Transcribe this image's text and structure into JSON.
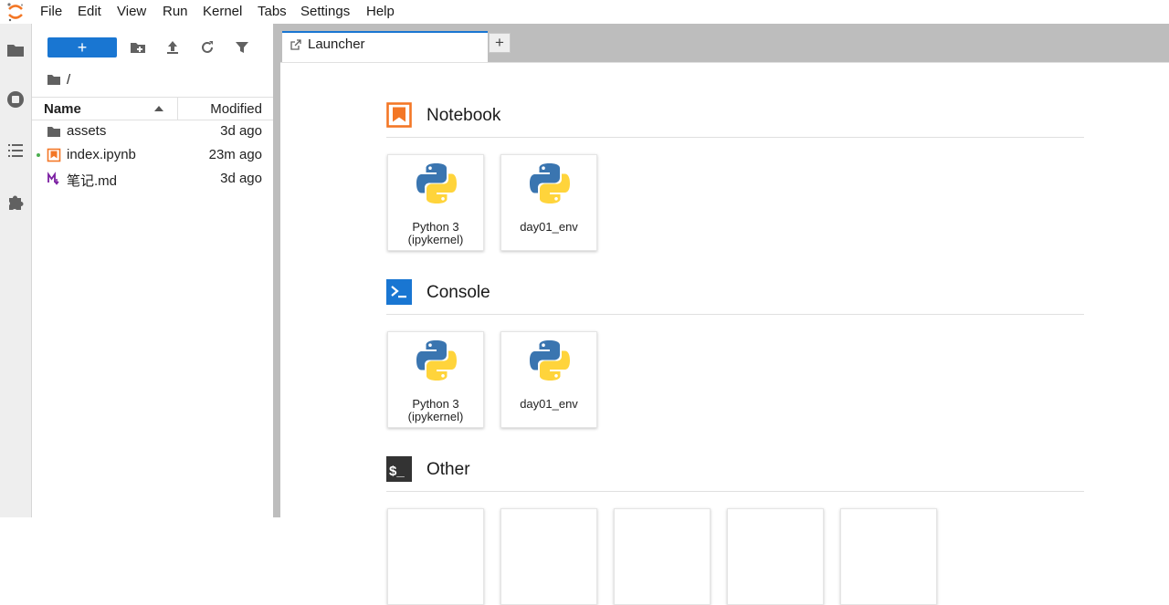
{
  "menu": [
    "File",
    "Edit",
    "View",
    "Run",
    "Kernel",
    "Tabs",
    "Settings",
    "Help"
  ],
  "filebrowser": {
    "new_label": "+",
    "breadcrumb": "/",
    "columns": {
      "name": "Name",
      "modified": "Modified"
    },
    "files": [
      {
        "name": "assets",
        "modified": "3d ago",
        "type": "folder"
      },
      {
        "name": "index.ipynb",
        "modified": "23m ago",
        "type": "notebook",
        "running": true
      },
      {
        "name": "笔记.md",
        "modified": "3d ago",
        "type": "markdown"
      }
    ]
  },
  "tabs": {
    "launcher_label": "Launcher",
    "add_label": "+"
  },
  "launcher": {
    "sections": [
      {
        "title": "Notebook",
        "icon": "notebook-icon",
        "cards": [
          {
            "line1": "Python 3",
            "line2": "(ipykernel)"
          },
          {
            "line1": "day01_env",
            "line2": ""
          }
        ]
      },
      {
        "title": "Console",
        "icon": "console-icon",
        "cards": [
          {
            "line1": "Python 3",
            "line2": "(ipykernel)"
          },
          {
            "line1": "day01_env",
            "line2": ""
          }
        ]
      },
      {
        "title": "Other",
        "icon": "terminal-icon",
        "cards": []
      }
    ]
  },
  "colors": {
    "accent": "#1976d2",
    "notebook_orange": "#f37726",
    "markdown_purple": "#7b1fa2",
    "folder": "#616161"
  }
}
